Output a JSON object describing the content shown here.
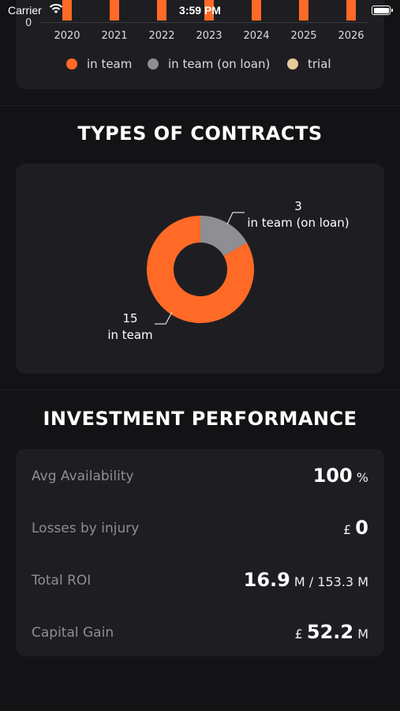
{
  "status_bar": {
    "carrier": "Carrier",
    "time": "3:59 PM"
  },
  "bar_chart": {
    "zero_label": "0",
    "years": [
      "2020",
      "2021",
      "2022",
      "2023",
      "2024",
      "2025",
      "2026"
    ]
  },
  "legend": [
    {
      "label": "in team",
      "color": "#ff6a26"
    },
    {
      "label": "in team (on loan)",
      "color": "#8e8e93"
    },
    {
      "label": "trial",
      "color": "#e8c99a"
    }
  ],
  "contracts": {
    "title": "TYPES OF CONTRACTS",
    "chart_data": {
      "type": "pie",
      "categories": [
        "in team",
        "in team (on loan)"
      ],
      "values": [
        15,
        3
      ],
      "colors": [
        "#ff6a26",
        "#8e8e93"
      ],
      "labels": [
        {
          "value": "15",
          "name": "in team"
        },
        {
          "value": "3",
          "name": "in team (on loan)"
        }
      ]
    }
  },
  "investment": {
    "title": "INVESTMENT PERFORMANCE",
    "rows": [
      {
        "label": "Avg Availability",
        "prefix": "",
        "value": "100",
        "suffix": " %"
      },
      {
        "label": "Losses by injury",
        "prefix": "£ ",
        "value": "0",
        "suffix": ""
      },
      {
        "label": "Total ROI",
        "prefix": "",
        "value": "16.9",
        "suffix": " M / 153.3 M"
      },
      {
        "label": "Capital Gain",
        "prefix": "£ ",
        "value": "52.2",
        "suffix": " M"
      }
    ]
  }
}
